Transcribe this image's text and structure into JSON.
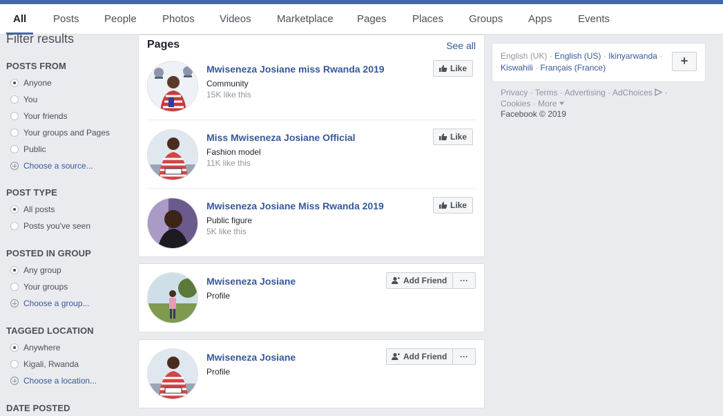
{
  "tabs": [
    {
      "label": "All",
      "active": true
    },
    {
      "label": "Posts"
    },
    {
      "label": "People"
    },
    {
      "label": "Photos"
    },
    {
      "label": "Videos"
    },
    {
      "label": "Marketplace"
    },
    {
      "label": "Pages"
    },
    {
      "label": "Places"
    },
    {
      "label": "Groups"
    },
    {
      "label": "Apps"
    },
    {
      "label": "Events"
    }
  ],
  "filters": {
    "title": "Filter results",
    "sections": [
      {
        "heading": "POSTS FROM",
        "options": [
          "Anyone",
          "You",
          "Your friends",
          "Your groups and Pages",
          "Public"
        ],
        "selected": "Anyone",
        "add_link": "Choose a source..."
      },
      {
        "heading": "POST TYPE",
        "options": [
          "All posts",
          "Posts you've seen"
        ],
        "selected": "All posts"
      },
      {
        "heading": "POSTED IN GROUP",
        "options": [
          "Any group",
          "Your groups"
        ],
        "selected": "Any group",
        "add_link": "Choose a group..."
      },
      {
        "heading": "TAGGED LOCATION",
        "options": [
          "Anywhere",
          "Kigali, Rwanda"
        ],
        "selected": "Anywhere",
        "add_link": "Choose a location..."
      },
      {
        "heading": "DATE POSTED"
      }
    ]
  },
  "pages_card": {
    "title": "Pages",
    "see_all": "See all",
    "items": [
      {
        "name": "Mwiseneza Josiane miss Rwanda 2019",
        "category": "Community",
        "likes": "15K like this",
        "button": "Like"
      },
      {
        "name": "Miss Mwiseneza Josiane Official",
        "category": "Fashion model",
        "likes": "11K like this",
        "button": "Like"
      },
      {
        "name": "Mwiseneza Josiane Miss Rwanda 2019",
        "category": "Public figure",
        "likes": "5K like this",
        "button": "Like"
      }
    ]
  },
  "people": [
    {
      "name": "Mwiseneza Josiane",
      "subtitle": "Profile",
      "button": "Add Friend",
      "more": "···"
    },
    {
      "name": "Mwiseneza Josiane",
      "subtitle": "Profile",
      "button": "Add Friend",
      "more": "···"
    }
  ],
  "right": {
    "languages": {
      "current": "English (UK)",
      "others": [
        "English (US)",
        "Ikinyarwanda",
        "Kiswahili",
        "Français (France)"
      ],
      "add_button": "+"
    },
    "footer_links": [
      "Privacy",
      "Terms",
      "Advertising",
      "AdChoices",
      "Cookies",
      "More"
    ],
    "copyright": "Facebook © 2019"
  },
  "colors": {
    "brand": "#4267b2",
    "link": "#365899",
    "background": "#e9ebee"
  }
}
